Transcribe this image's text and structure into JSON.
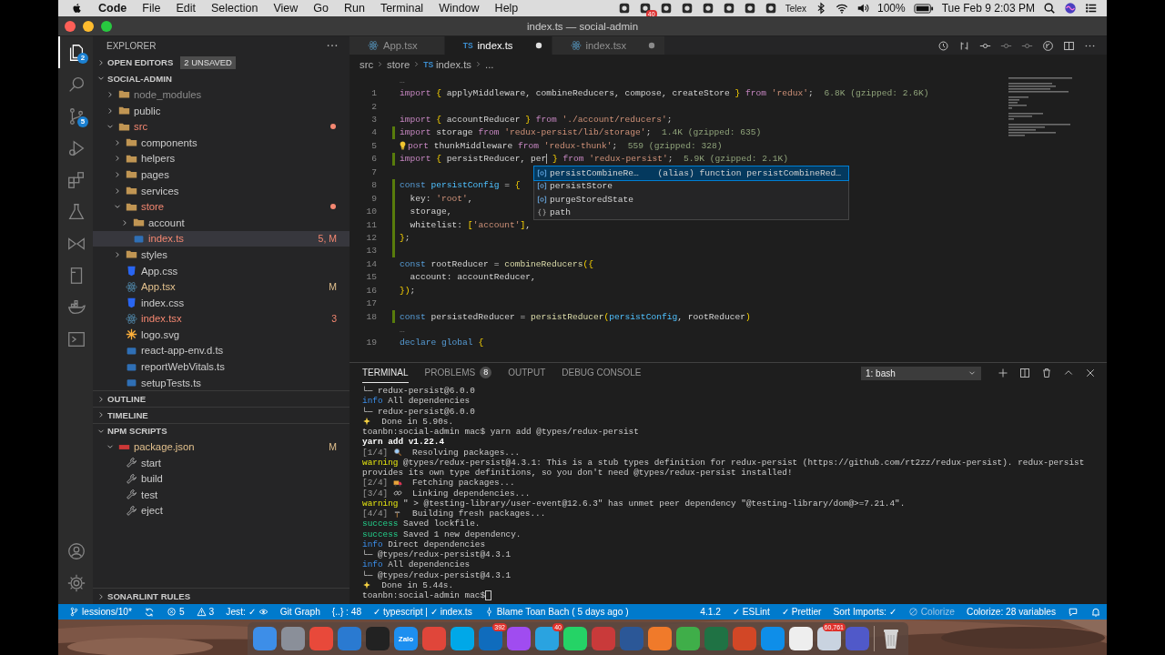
{
  "menubar": {
    "menus": [
      {
        "label": "Code",
        "kind": "app"
      },
      {
        "label": "File",
        "kind": "menu"
      },
      {
        "label": "Edit",
        "kind": "menu"
      },
      {
        "label": "Selection",
        "kind": "menu"
      },
      {
        "label": "View",
        "kind": "menu"
      },
      {
        "label": "Go",
        "kind": "menu"
      },
      {
        "label": "Run",
        "kind": "menu"
      },
      {
        "label": "Terminal",
        "kind": "menu"
      },
      {
        "label": "Window",
        "kind": "menu"
      },
      {
        "label": "Help",
        "kind": "menu"
      }
    ],
    "tray": [
      {
        "kind": "app"
      },
      {
        "kind": "app",
        "badge": "40"
      },
      {
        "kind": "app"
      },
      {
        "kind": "app"
      },
      {
        "kind": "app"
      },
      {
        "kind": "app"
      },
      {
        "kind": "app"
      },
      {
        "kind": "app"
      },
      {
        "kind": "input",
        "text": "Telex"
      },
      {
        "kind": "bluetooth"
      },
      {
        "kind": "wifi"
      },
      {
        "kind": "volume"
      },
      {
        "kind": "percent",
        "text": "100%"
      },
      {
        "kind": "battery"
      },
      {
        "kind": "clock",
        "text": "Tue Feb 9  2:03 PM"
      },
      {
        "kind": "search"
      },
      {
        "kind": "siri"
      },
      {
        "kind": "control"
      }
    ]
  },
  "window": {
    "title": "index.ts — social-admin"
  },
  "activity_bar": {
    "top": [
      {
        "kind": "files",
        "selected": true,
        "badge": "2"
      },
      {
        "kind": "search",
        "selected": false
      },
      {
        "kind": "scm",
        "selected": false,
        "badge": "5"
      },
      {
        "kind": "debug",
        "selected": false
      },
      {
        "kind": "extensions",
        "selected": false
      },
      {
        "kind": "testing",
        "selected": false
      },
      {
        "kind": "liveshare",
        "selected": false
      },
      {
        "kind": "notebook",
        "selected": false
      },
      {
        "kind": "docker",
        "selected": false
      },
      {
        "kind": "remote",
        "selected": false
      }
    ],
    "bottom": [
      {
        "kind": "account",
        "selected": false
      },
      {
        "kind": "settings",
        "selected": false
      }
    ]
  },
  "sidebar": {
    "title": "EXPLORER",
    "sections": [
      {
        "title": "OPEN EDITORS",
        "expanded": false,
        "badge": "2 UNSAVED"
      },
      {
        "title": "SOCIAL-ADMIN",
        "expanded": true,
        "tree": [
          {
            "name": "node_modules",
            "kind": "folder",
            "color": "#8c8c8c",
            "expanded": false,
            "dot": false,
            "selected": false
          },
          {
            "name": "public",
            "kind": "folder",
            "color": "#cccccc",
            "expanded": false,
            "dot": false,
            "selected": false
          },
          {
            "name": "src",
            "kind": "folder",
            "color": "#f48771",
            "expanded": true,
            "dot": true,
            "selected": false,
            "children": [
              {
                "name": "components",
                "kind": "folder",
                "color": "#cccccc",
                "expanded": false,
                "dot": false,
                "selected": false
              },
              {
                "name": "helpers",
                "kind": "folder",
                "color": "#cccccc",
                "expanded": false,
                "dot": false,
                "selected": false
              },
              {
                "name": "pages",
                "kind": "folder",
                "color": "#cccccc",
                "expanded": false,
                "dot": false,
                "selected": false
              },
              {
                "name": "services",
                "kind": "folder",
                "color": "#cccccc",
                "expanded": false,
                "dot": false,
                "selected": false
              },
              {
                "name": "store",
                "kind": "folder",
                "color": "#f48771",
                "expanded": true,
                "dot": true,
                "selected": false,
                "children": [
                  {
                    "name": "account",
                    "kind": "folder",
                    "color": "#cccccc",
                    "expanded": false,
                    "dot": false,
                    "selected": false
                  },
                  {
                    "name": "index.ts",
                    "kind": "ts",
                    "color": "#f48771",
                    "badge": "5, M",
                    "selected": true
                  }
                ]
              },
              {
                "name": "styles",
                "kind": "folder",
                "color": "#cccccc",
                "expanded": false,
                "dot": false,
                "selected": false
              },
              {
                "name": "App.css",
                "kind": "css",
                "color": "#cccccc",
                "selected": false
              },
              {
                "name": "App.tsx",
                "kind": "react",
                "color": "#e2c08d",
                "badge": "M",
                "selected": false
              },
              {
                "name": "index.css",
                "kind": "css",
                "color": "#cccccc",
                "selected": false
              },
              {
                "name": "index.tsx",
                "kind": "react",
                "color": "#f48771",
                "badge": "3",
                "selected": false
              },
              {
                "name": "logo.svg",
                "kind": "svg",
                "color": "#cccccc",
                "selected": false
              },
              {
                "name": "react-app-env.d.ts",
                "kind": "ts",
                "color": "#cccccc",
                "selected": false
              },
              {
                "name": "reportWebVitals.ts",
                "kind": "ts",
                "color": "#cccccc",
                "selected": false
              },
              {
                "name": "setupTests.ts",
                "kind": "ts",
                "color": "#cccccc",
                "selected": false
              }
            ]
          }
        ]
      },
      {
        "title": "OUTLINE",
        "expanded": false
      },
      {
        "title": "TIMELINE",
        "expanded": false
      },
      {
        "title": "NPM SCRIPTS",
        "expanded": true,
        "tree": [
          {
            "name": "package.json",
            "kind": "npm",
            "color": "#e2c08d",
            "badge": "M",
            "expanded": true,
            "selected": false,
            "children": [
              {
                "name": "start",
                "kind": "script",
                "color": "#cccccc",
                "selected": false
              },
              {
                "name": "build",
                "kind": "script",
                "color": "#cccccc",
                "selected": false
              },
              {
                "name": "test",
                "kind": "script",
                "color": "#cccccc",
                "selected": false
              },
              {
                "name": "eject",
                "kind": "script",
                "color": "#cccccc",
                "selected": false
              }
            ]
          }
        ]
      },
      {
        "title": "SONARLINT RULES",
        "expanded": false
      }
    ]
  },
  "editor": {
    "tabs": [
      {
        "label": "App.tsx",
        "kind": "react",
        "selected": false,
        "dirty": false
      },
      {
        "label": "index.ts",
        "kind": "ts",
        "type_label": "TS",
        "selected": true,
        "dirty": true
      },
      {
        "label": "index.tsx",
        "kind": "react",
        "selected": false,
        "dirty": true
      }
    ],
    "breadcrumbs": [
      {
        "text": "src"
      },
      {
        "text": "store"
      },
      {
        "text": "index.ts",
        "type_label": "TS"
      },
      {
        "text": "..."
      }
    ],
    "lines": [
      {
        "kind": "fold",
        "text": "…"
      },
      {
        "kind": "code",
        "number": "1",
        "changed": false,
        "tokens": [
          {
            "kind": "keyword",
            "text": "import "
          },
          {
            "kind": "brace",
            "text": "{"
          },
          {
            "kind": "name",
            "text": " applyMiddleware, combineReducers, compose, createStore "
          },
          {
            "kind": "brace",
            "text": "}"
          },
          {
            "kind": "keyword",
            "text": " from "
          },
          {
            "kind": "string",
            "text": "'redux'"
          },
          {
            "kind": "punct",
            "text": ";"
          },
          {
            "kind": "hint",
            "text": "  6.8K (gzipped: 2.6K)"
          }
        ]
      },
      {
        "kind": "code",
        "number": "2",
        "changed": false
      },
      {
        "kind": "code",
        "number": "3",
        "changed": false,
        "tokens": [
          {
            "kind": "keyword",
            "text": "import "
          },
          {
            "kind": "brace",
            "text": "{"
          },
          {
            "kind": "name",
            "text": " accountReducer "
          },
          {
            "kind": "brace",
            "text": "}"
          },
          {
            "kind": "keyword",
            "text": " from "
          },
          {
            "kind": "string",
            "text": "'./account/reducers'"
          },
          {
            "kind": "punct",
            "text": ";"
          }
        ]
      },
      {
        "kind": "code",
        "number": "4",
        "changed": true,
        "tokens": [
          {
            "kind": "keyword",
            "text": "import "
          },
          {
            "kind": "name",
            "text": "storage "
          },
          {
            "kind": "keyword",
            "text": "from "
          },
          {
            "kind": "string",
            "text": "'redux-persist/lib/storage'"
          },
          {
            "kind": "punct",
            "text": ";"
          },
          {
            "kind": "hint",
            "text": "  1.4K (gzipped: 635)"
          }
        ]
      },
      {
        "kind": "code",
        "number": "5",
        "changed": false,
        "bulb": true,
        "tokens": [
          {
            "kind": "keyword",
            "text": "port "
          },
          {
            "kind": "name",
            "text": "thunkMiddleware "
          },
          {
            "kind": "keyword",
            "text": "from "
          },
          {
            "kind": "string",
            "text": "'redux-thunk'"
          },
          {
            "kind": "punct",
            "text": ";"
          },
          {
            "kind": "hint",
            "text": "  559 (gzipped: 328)"
          }
        ]
      },
      {
        "kind": "code",
        "number": "6",
        "changed": true,
        "tokens": [
          {
            "kind": "keyword",
            "text": "import "
          },
          {
            "kind": "brace",
            "text": "{"
          },
          {
            "kind": "name",
            "text": " persistReducer, per"
          },
          {
            "kind": "cursor"
          },
          {
            "kind": "brace",
            "text": " }"
          },
          {
            "kind": "keyword",
            "text": " from "
          },
          {
            "kind": "string",
            "text": "'redux-persist'"
          },
          {
            "kind": "punct",
            "text": ";"
          },
          {
            "kind": "hint",
            "text": "  5.9K (gzipped: 2.1K)"
          }
        ]
      },
      {
        "kind": "code",
        "number": "7",
        "changed": false
      },
      {
        "kind": "code",
        "number": "8",
        "changed": true,
        "tokens": [
          {
            "kind": "storage",
            "text": "const "
          },
          {
            "kind": "var",
            "text": "persistConfig"
          },
          {
            "kind": "punct",
            "text": " = "
          },
          {
            "kind": "brace",
            "text": "{"
          }
        ]
      },
      {
        "kind": "code",
        "number": "9",
        "changed": true,
        "tokens": [
          {
            "kind": "name",
            "text": "  key"
          },
          {
            "kind": "punct",
            "text": ": "
          },
          {
            "kind": "string",
            "text": "'root'"
          },
          {
            "kind": "punct",
            "text": ","
          }
        ]
      },
      {
        "kind": "code",
        "number": "10",
        "changed": true,
        "tokens": [
          {
            "kind": "name",
            "text": "  storage"
          },
          {
            "kind": "punct",
            "text": ","
          }
        ]
      },
      {
        "kind": "code",
        "number": "11",
        "changed": true,
        "tokens": [
          {
            "kind": "name",
            "text": "  whitelist"
          },
          {
            "kind": "punct",
            "text": ": "
          },
          {
            "kind": "brace",
            "text": "["
          },
          {
            "kind": "string",
            "text": "'account'"
          },
          {
            "kind": "brace",
            "text": "]"
          },
          {
            "kind": "punct",
            "text": ","
          }
        ]
      },
      {
        "kind": "code",
        "number": "12",
        "changed": true,
        "tokens": [
          {
            "kind": "brace",
            "text": "}"
          },
          {
            "kind": "punct",
            "text": ";"
          }
        ]
      },
      {
        "kind": "code",
        "number": "13",
        "changed": true
      },
      {
        "kind": "code",
        "number": "14",
        "changed": false,
        "tokens": [
          {
            "kind": "storage",
            "text": "const "
          },
          {
            "kind": "name",
            "text": "rootReducer"
          },
          {
            "kind": "punct",
            "text": " = "
          },
          {
            "kind": "func",
            "text": "combineReducers"
          },
          {
            "kind": "brace",
            "text": "({"
          }
        ]
      },
      {
        "kind": "code",
        "number": "15",
        "changed": false,
        "tokens": [
          {
            "kind": "name",
            "text": "  account"
          },
          {
            "kind": "punct",
            "text": ": "
          },
          {
            "kind": "name",
            "text": "accountReducer"
          },
          {
            "kind": "punct",
            "text": ","
          }
        ]
      },
      {
        "kind": "code",
        "number": "16",
        "changed": false,
        "tokens": [
          {
            "kind": "brace",
            "text": "})"
          },
          {
            "kind": "punct",
            "text": ";"
          }
        ]
      },
      {
        "kind": "code",
        "number": "17",
        "changed": false
      },
      {
        "kind": "code",
        "number": "18",
        "changed": true,
        "tokens": [
          {
            "kind": "storage",
            "text": "const "
          },
          {
            "kind": "name",
            "text": "persistedReducer"
          },
          {
            "kind": "punct",
            "text": " = "
          },
          {
            "kind": "func",
            "text": "persistReducer"
          },
          {
            "kind": "brace",
            "text": "("
          },
          {
            "kind": "var",
            "text": "persistConfig"
          },
          {
            "kind": "punct",
            "text": ", "
          },
          {
            "kind": "name",
            "text": "rootReducer"
          },
          {
            "kind": "brace",
            "text": ")"
          }
        ]
      },
      {
        "kind": "fold",
        "text": "…"
      },
      {
        "kind": "code",
        "number": "19",
        "changed": false,
        "tokens": [
          {
            "kind": "storage",
            "text": "declare "
          },
          {
            "kind": "storage",
            "text": "global "
          },
          {
            "kind": "brace",
            "text": "{"
          }
        ]
      }
    ],
    "suggestions": [
      {
        "kind": "variable",
        "label": "persistCombineRe…",
        "detail": "(alias) function persistCombineRed…",
        "selected": true
      },
      {
        "kind": "variable",
        "label": "persistStore",
        "selected": false
      },
      {
        "kind": "variable",
        "label": "purgeStoredState",
        "selected": false
      },
      {
        "kind": "module",
        "label": "path",
        "selected": false
      }
    ]
  },
  "panel": {
    "tabs": [
      {
        "label": "TERMINAL",
        "selected": true
      },
      {
        "label": "PROBLEMS",
        "badge": "8",
        "selected": false
      },
      {
        "label": "OUTPUT",
        "selected": false
      },
      {
        "label": "DEBUG CONSOLE",
        "selected": false
      }
    ],
    "terminal_select": "1: bash",
    "lines": [
      [
        {
          "kind": "plain",
          "text": "└─ redux-persist@6.0.0"
        }
      ],
      [
        {
          "kind": "info",
          "text": "info"
        },
        {
          "kind": "plain",
          "text": " All dependencies"
        }
      ],
      [
        {
          "kind": "plain",
          "text": "└─ redux-persist@6.0.0"
        }
      ],
      [
        {
          "kind": "sparkles"
        },
        {
          "kind": "plain",
          "text": "  Done in 5.90s."
        }
      ],
      [
        {
          "kind": "plain",
          "text": "toanbn:social-admin mac$ yarn add @types/redux-persist"
        }
      ],
      [
        {
          "kind": "bold",
          "text": "yarn add v1.22.4"
        }
      ],
      [
        {
          "kind": "step",
          "text": "[1/4] "
        },
        {
          "kind": "magnifier"
        },
        {
          "kind": "plain",
          "text": "  Resolving packages..."
        }
      ],
      [
        {
          "kind": "warning",
          "text": "warning"
        },
        {
          "kind": "plain",
          "text": " @types/redux-persist@4.3.1: This is a stub types definition for redux-persist (https://github.com/rt2zz/redux-persist). redux-persist"
        }
      ],
      [
        {
          "kind": "plain",
          "text": "provides its own type definitions, so you don't need @types/redux-persist installed!"
        }
      ],
      [
        {
          "kind": "step",
          "text": "[2/4] "
        },
        {
          "kind": "truck"
        },
        {
          "kind": "plain",
          "text": "  Fetching packages..."
        }
      ],
      [
        {
          "kind": "step",
          "text": "[3/4] "
        },
        {
          "kind": "link"
        },
        {
          "kind": "plain",
          "text": "  Linking dependencies..."
        }
      ],
      [
        {
          "kind": "warning",
          "text": "warning"
        },
        {
          "kind": "plain",
          "text": " \" > @testing-library/user-event@12.6.3\" has unmet peer dependency \"@testing-library/dom@>=7.21.4\"."
        }
      ],
      [
        {
          "kind": "step",
          "text": "[4/4] "
        },
        {
          "kind": "hammer"
        },
        {
          "kind": "plain",
          "text": "  Building fresh packages..."
        }
      ],
      [
        {
          "kind": "success",
          "text": "success"
        },
        {
          "kind": "plain",
          "text": " Saved lockfile."
        }
      ],
      [
        {
          "kind": "success",
          "text": "success"
        },
        {
          "kind": "plain",
          "text": " Saved 1 new dependency."
        }
      ],
      [
        {
          "kind": "info",
          "text": "info"
        },
        {
          "kind": "plain",
          "text": " Direct dependencies"
        }
      ],
      [
        {
          "kind": "plain",
          "text": "└─ @types/redux-persist@4.3.1"
        }
      ],
      [
        {
          "kind": "info",
          "text": "info"
        },
        {
          "kind": "plain",
          "text": " All dependencies"
        }
      ],
      [
        {
          "kind": "plain",
          "text": "└─ @types/redux-persist@4.3.1"
        }
      ],
      [
        {
          "kind": "sparkles"
        },
        {
          "kind": "plain",
          "text": "  Done in 5.44s."
        }
      ],
      [
        {
          "kind": "plain",
          "text": "toanbn:social-admin mac$"
        },
        {
          "kind": "cursor"
        }
      ]
    ]
  },
  "status_bar": {
    "left": [
      {
        "kind": "branch",
        "text": "lessions/10*"
      },
      {
        "kind": "sync"
      },
      {
        "kind": "error",
        "text": "5"
      },
      {
        "kind": "warning",
        "text": "3"
      },
      {
        "kind": "jest",
        "text": "Jest: ✓"
      },
      {
        "kind": "plain",
        "text": "Git Graph"
      },
      {
        "kind": "plain",
        "text": "{..} : 48"
      },
      {
        "kind": "plain",
        "text": "✓ typescript | ✓ index.ts"
      },
      {
        "kind": "blame",
        "text": "Blame Toan Bach ( 5 days ago )"
      }
    ],
    "right": [
      {
        "kind": "plain",
        "text": "4.1.2"
      },
      {
        "kind": "plain",
        "text": "✓ ESLint"
      },
      {
        "kind": "plain",
        "text": "✓ Prettier"
      },
      {
        "kind": "plain",
        "text": "Sort Imports: ✓"
      },
      {
        "kind": "disabled",
        "text": "Colorize"
      },
      {
        "kind": "plain",
        "text": "Colorize: 28 variables"
      },
      {
        "kind": "feedback"
      },
      {
        "kind": "bell"
      }
    ]
  },
  "dock": [
    {
      "kind": "app",
      "color": "#3d8ee8"
    },
    {
      "kind": "app",
      "color": "#8a8f99"
    },
    {
      "kind": "app",
      "color": "#e8493a"
    },
    {
      "kind": "app",
      "color": "#2a7ad1"
    },
    {
      "kind": "app",
      "color": "#222222"
    },
    {
      "kind": "app",
      "color": "#1d8ff0",
      "label": "Zalo"
    },
    {
      "kind": "app",
      "color": "#e0463a"
    },
    {
      "kind": "app",
      "color": "#00a8e8"
    },
    {
      "kind": "app",
      "color": "#0f6cbd",
      "badge": "392"
    },
    {
      "kind": "app",
      "color": "#a04cf0"
    },
    {
      "kind": "app",
      "color": "#2aa3e0",
      "badge": "40"
    },
    {
      "kind": "app",
      "color": "#25d366"
    },
    {
      "kind": "app",
      "color": "#c93a3a"
    },
    {
      "kind": "app",
      "color": "#2b5797"
    },
    {
      "kind": "app",
      "color": "#f07a2a"
    },
    {
      "kind": "app",
      "color": "#3fae49"
    },
    {
      "kind": "app",
      "color": "#1f7244"
    },
    {
      "kind": "app",
      "color": "#d24726"
    },
    {
      "kind": "app",
      "color": "#0e8ee9"
    },
    {
      "kind": "app",
      "color": "#eeeeee"
    },
    {
      "kind": "app",
      "color": "#c9d3e0",
      "badge": "60,761"
    },
    {
      "kind": "app",
      "color": "#5059c9"
    },
    {
      "kind": "separator"
    },
    {
      "kind": "trash",
      "color": "#d5d5d5"
    }
  ]
}
